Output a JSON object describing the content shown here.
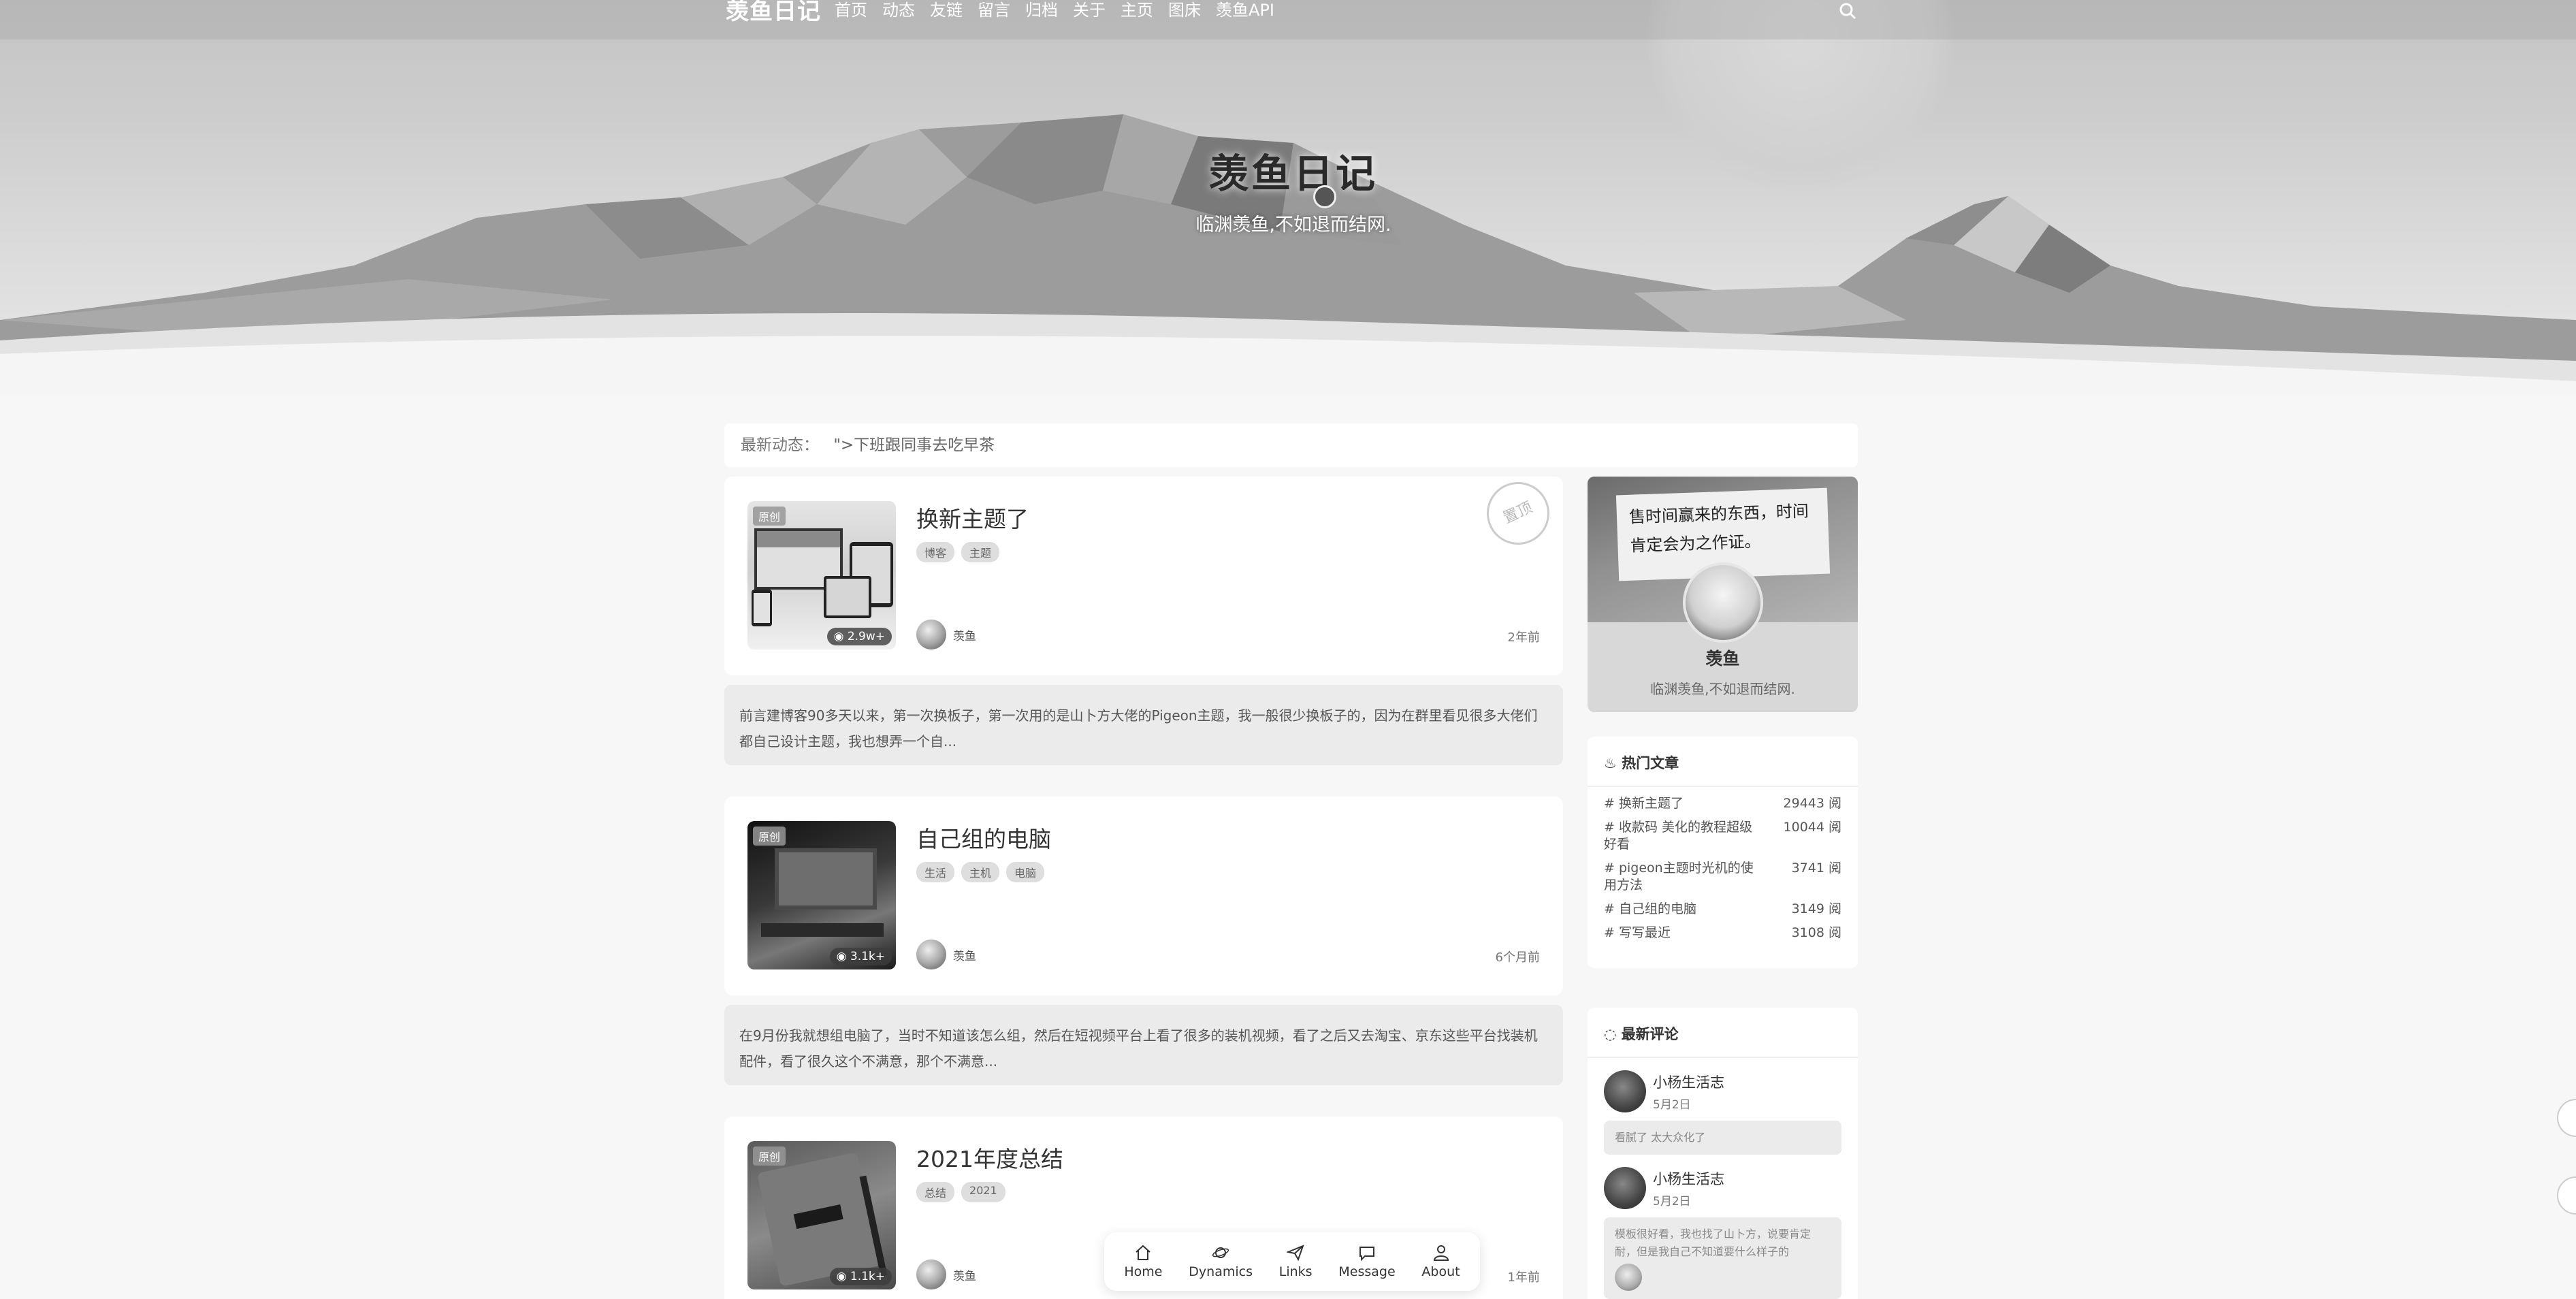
{
  "nav": {
    "brand": "羡鱼日记",
    "items": [
      "首页",
      "动态",
      "友链",
      "留言",
      "归档",
      "关于",
      "主页",
      "图床",
      "羡鱼API"
    ]
  },
  "hero": {
    "title": "羡鱼日记",
    "subtitle": "临渊羡鱼,不如退而结网."
  },
  "announce": {
    "label": "最新动态：",
    "text": "\">下班跟同事去吃早茶"
  },
  "posts": [
    {
      "title": "换新主题了",
      "tags": [
        "博客",
        "主题"
      ],
      "author": "羡鱼",
      "time": "2年前",
      "views": "2.9w+",
      "badge": "原创",
      "stamp": "置顶",
      "excerpt": "前言建博客90多天以来，第一次换板子，第一次用的是山卜方大佬的Pigeon主题，我一般很少换板子的，因为在群里看见很多大佬们都自己设计主题，我也想弄一个自..."
    },
    {
      "title": "自己组的电脑",
      "tags": [
        "生活",
        "主机",
        "电脑"
      ],
      "author": "羡鱼",
      "time": "6个月前",
      "views": "3.1k+",
      "badge": "原创",
      "excerpt": "在9月份我就想组电脑了，当时不知道该怎么组，然后在短视频平台上看了很多的装机视频，看了之后又去淘宝、京东这些平台找装机配件，看了很久这个不满意，那个不满意..."
    },
    {
      "title": "2021年度总结",
      "tags": [
        "总结",
        "2021"
      ],
      "author": "羡鱼",
      "time": "1年前",
      "views": "1.1k+",
      "badge": "原创"
    }
  ],
  "profile": {
    "note": "售时间赢来的东西，时间肯定会为之作证。",
    "name": "羡鱼",
    "desc": "临渊羡鱼,不如退而结网."
  },
  "hot": {
    "title": "热门文章",
    "items": [
      {
        "title": "# 换新主题了",
        "views": "29443 阅"
      },
      {
        "title": "# 收款码 美化的教程超级好看",
        "views": "10044 阅"
      },
      {
        "title": "# pigeon主题时光机的使用方法",
        "views": "3741 阅"
      },
      {
        "title": "# 自己组的电脑",
        "views": "3149 阅"
      },
      {
        "title": "# 写写最近",
        "views": "3108 阅"
      }
    ]
  },
  "comments": {
    "title": "最新评论",
    "items": [
      {
        "name": "小杨生活志",
        "date": "5月2日",
        "body": "看腻了 太大众化了"
      },
      {
        "name": "小杨生活志",
        "date": "5月2日",
        "body": "模板很好看，我也找了山卜方，说要肯定耐，但是我自己不知道要什么样子的"
      }
    ]
  },
  "dock": {
    "items": [
      "Home",
      "Dynamics",
      "Links",
      "Message",
      "About"
    ]
  }
}
